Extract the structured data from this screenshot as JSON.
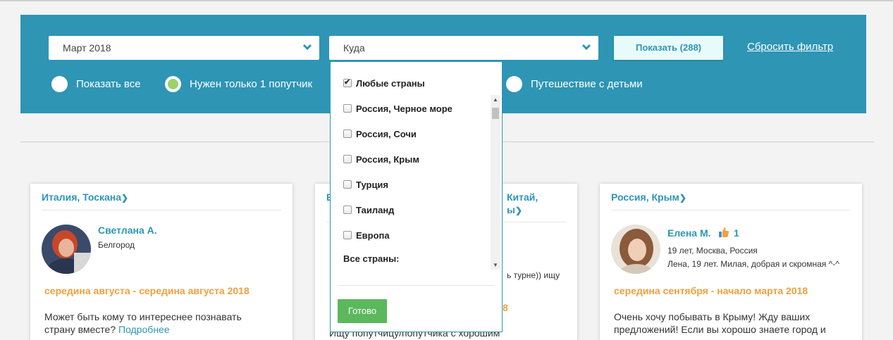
{
  "filter": {
    "date_value": "Март 2018",
    "where_placeholder": "Куда",
    "show_button": "Показать (288)",
    "reset_link": "Сбросить фильтр",
    "radios": [
      {
        "label": "Показать все",
        "selected": false
      },
      {
        "label": "Нужен только 1 попутчик",
        "selected": true
      },
      {
        "label": "Путешествие с детьми",
        "selected": false
      }
    ]
  },
  "dropdown": {
    "options": [
      {
        "label": "Любые страны",
        "checked": true
      },
      {
        "label": "Россия, Черное море",
        "checked": false
      },
      {
        "label": "Россия, Сочи",
        "checked": false
      },
      {
        "label": "Россия, Крым",
        "checked": false
      },
      {
        "label": "Турция",
        "checked": false
      },
      {
        "label": "Таиланд",
        "checked": false
      },
      {
        "label": "Европа",
        "checked": false
      }
    ],
    "all_countries_label": "Все страны:",
    "done_button": "Готово"
  },
  "cards": [
    {
      "location": "Италия, Тоскана",
      "user_name": "Светлана А.",
      "user_city": "Белгород",
      "dates": "середина августа - середина августа 2018",
      "description": "Может быть кому то интереснее познавать страну вместе?",
      "more_link": "Подробнее"
    },
    {
      "location_left": "В",
      "location_right": "Китай,",
      "location_line2_right": "ы",
      "snippet": "ь турне)) ищу",
      "dates_tail": "8",
      "description": "Ищу попутчицу/попутчика с хорошим"
    },
    {
      "location": "Россия, Крым",
      "user_name": "Елена М.",
      "likes": "1",
      "user_info": "19 лет, Москва, Россия",
      "user_bio": "Лена, 19 лет. Милая, добрая и скромная ^-^",
      "dates": "середина сентября - начало марта 2018",
      "description": "Очень хочу побывать в Крыму! Жду ваших предложений! Если вы хорошо знаете город и сможете показать мне самые интересные"
    }
  ],
  "colors": {
    "accent": "#2e95b5",
    "date_orange": "#f0a040",
    "done_green": "#5cb85c",
    "radio_selected": "#9bd36a"
  }
}
